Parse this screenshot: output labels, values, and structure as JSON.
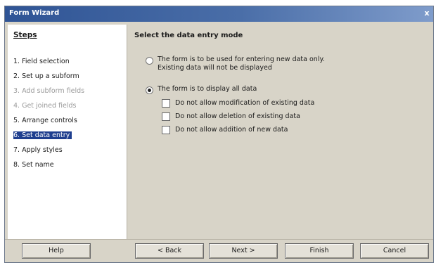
{
  "window": {
    "title": "Form Wizard",
    "close_glyph": "x"
  },
  "steps": {
    "header": "Steps",
    "items": [
      {
        "label": "1. Field selection",
        "state": "normal"
      },
      {
        "label": "2. Set up a subform",
        "state": "normal"
      },
      {
        "label": "3. Add subform fields",
        "state": "disabled"
      },
      {
        "label": "4. Get joined fields",
        "state": "disabled"
      },
      {
        "label": "5. Arrange controls",
        "state": "normal"
      },
      {
        "label": "6. Set data entry",
        "state": "active"
      },
      {
        "label": "7. Apply styles",
        "state": "normal"
      },
      {
        "label": "8. Set name",
        "state": "normal"
      }
    ]
  },
  "content": {
    "title": "Select the data entry mode",
    "radio_new_data": {
      "line1": "The form is to be used for entering new data only.",
      "line2": "Existing data will not be displayed",
      "checked": false
    },
    "radio_all_data": {
      "label": "The form is to display all data",
      "checked": true
    },
    "checkboxes": [
      {
        "label": "Do not allow modification of existing data",
        "checked": false
      },
      {
        "label": "Do not allow deletion of existing data",
        "checked": false
      },
      {
        "label": "Do not allow addition of new data",
        "checked": false
      }
    ]
  },
  "buttons": {
    "help": "Help",
    "back": "< Back",
    "next": "Next >",
    "finish": "Finish",
    "cancel": "Cancel"
  }
}
